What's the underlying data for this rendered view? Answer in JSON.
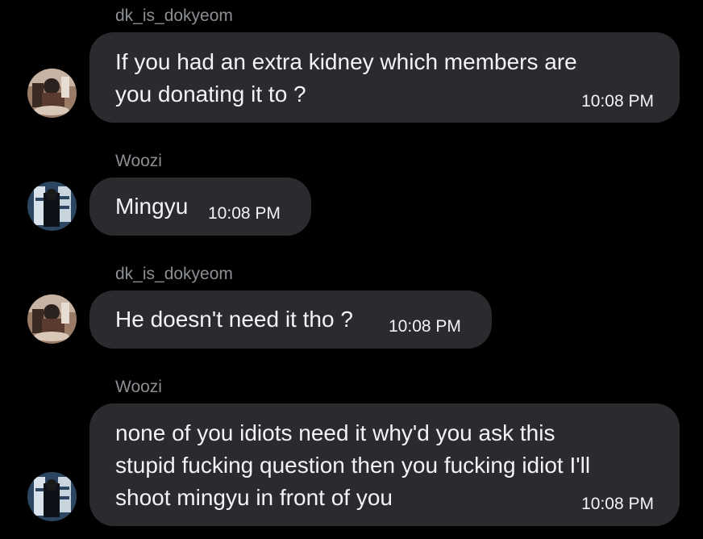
{
  "messages": [
    {
      "sender": "dk_is_dokyeom",
      "lines": [
        "If you had an extra kidney which members are",
        "you donating it to ?"
      ],
      "time": "10:08 PM",
      "avatar": "dokyeom-avatar"
    },
    {
      "sender": "Woozi",
      "lines": [
        "Mingyu"
      ],
      "time": "10:08 PM",
      "avatar": "woozi-avatar"
    },
    {
      "sender": "dk_is_dokyeom",
      "lines": [
        "He doesn't need it tho ?"
      ],
      "time": "10:08 PM",
      "avatar": "dokyeom-avatar"
    },
    {
      "sender": "Woozi",
      "lines": [
        "none of you idiots need it why'd you ask this",
        "stupid fucking question then you fucking idiot I'll",
        "shoot mingyu in front of you"
      ],
      "time": "10:08 PM",
      "avatar": "woozi-avatar"
    }
  ],
  "colors": {
    "background": "#000000",
    "bubble": "#2a2b2e",
    "sender_text": "#8b8f93",
    "message_text": "#f2f3f4"
  }
}
